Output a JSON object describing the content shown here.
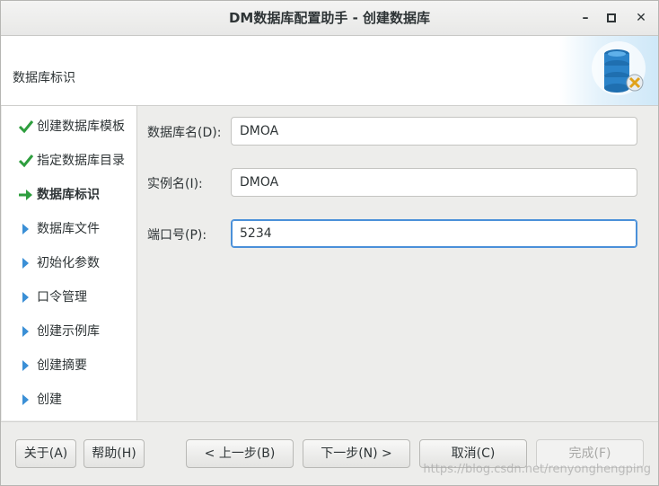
{
  "window": {
    "title": "DM数据库配置助手 - 创建数据库",
    "controls": {
      "minimize": "–",
      "maximize": "▫",
      "close": "✕"
    }
  },
  "header": {
    "title": "数据库标识",
    "logo_icon": "database-settings-icon"
  },
  "sidebar": {
    "steps": [
      {
        "label": "创建数据库模板",
        "state": "done"
      },
      {
        "label": "指定数据库目录",
        "state": "done"
      },
      {
        "label": "数据库标识",
        "state": "current"
      },
      {
        "label": "数据库文件",
        "state": "pending"
      },
      {
        "label": "初始化参数",
        "state": "pending"
      },
      {
        "label": "口令管理",
        "state": "pending"
      },
      {
        "label": "创建示例库",
        "state": "pending"
      },
      {
        "label": "创建摘要",
        "state": "pending"
      },
      {
        "label": "创建",
        "state": "pending"
      }
    ]
  },
  "form": {
    "db_name": {
      "label": "数据库名(D):",
      "value": "DMOA"
    },
    "instance_name": {
      "label": "实例名(I):",
      "value": "DMOA"
    },
    "port": {
      "label": "端口号(P):",
      "value": "5234"
    }
  },
  "buttons": {
    "about": "关于(A)",
    "help": "帮助(H)",
    "prev": "< 上一步(B)",
    "next": "下一步(N) >",
    "cancel": "取消(C)",
    "finish": "完成(F)"
  },
  "watermark": "https://blog.csdn.net/renyonghengping",
  "colors": {
    "check": "#2e9e3e",
    "arrow": "#3a8fd6",
    "focus": "#4a90d9"
  }
}
